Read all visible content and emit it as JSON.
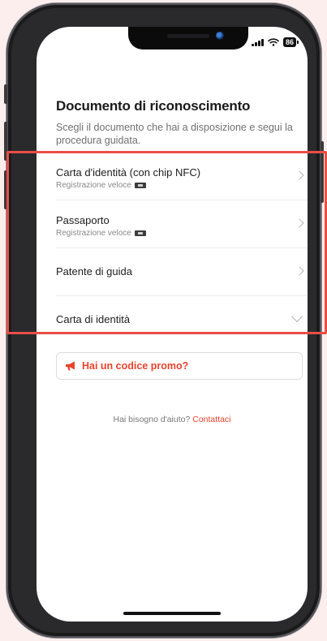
{
  "status_bar": {
    "battery": "86",
    "icons": [
      "signal-icon",
      "wifi-icon",
      "battery-icon"
    ]
  },
  "header": {
    "title": "Documento di riconoscimento",
    "subtitle": "Scegli il documento che hai a disposizione e segui la procedura guidata."
  },
  "documents": [
    {
      "name": "Carta d'identità (con chip NFC)",
      "subtitle": "Registrazione veloce",
      "icon": "chevron-right-icon"
    },
    {
      "name": "Passaporto",
      "subtitle": "Registrazione veloce",
      "icon": "chevron-right-icon"
    },
    {
      "name": "Patente di guida",
      "icon": "chevron-right-icon"
    },
    {
      "name": "Carta di identità",
      "icon": "chevron-down-icon"
    }
  ],
  "promo": {
    "label": "Hai un codice promo?",
    "icon": "megaphone-icon"
  },
  "help": {
    "text": "Hai bisogno d'aiuto?",
    "link": "Contattaci"
  },
  "colors": {
    "accent": "#e8432d",
    "highlight": "#e94e47",
    "background": "#fdeeee"
  }
}
